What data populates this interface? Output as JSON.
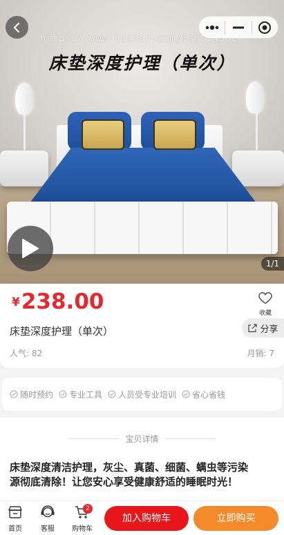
{
  "hero": {
    "title": "床垫深度护理（单次）",
    "watermark": "https://www.huzhan.com/ishop49364",
    "pager": "1/1"
  },
  "product": {
    "currency": "¥",
    "price": "238.00",
    "name": "床垫深度护理（单次）",
    "favorite_label": "收藏",
    "share_label": "分享",
    "popularity": "人气: 82",
    "monthly_sales": "月销: 7"
  },
  "services": [
    "随时预约",
    "专业工具",
    "人员受专业培训",
    "省心省钱"
  ],
  "detail": {
    "heading": "宝贝详情",
    "text": "床垫深度清洁护理，灰尘、真菌、细菌、螨虫等污染源彻底清除！让您安心享受健康舒适的睡眠时光！"
  },
  "bottom_bar": {
    "home_label": "首页",
    "service_label": "客服",
    "cart_label": "购物车",
    "cart_count": "2",
    "add_cart_label": "加入购物车",
    "buy_now_label": "立即购买"
  },
  "colors": {
    "price": "#e8262b",
    "add_cart": "#e8161b",
    "buy_now": "#f58a2a"
  }
}
